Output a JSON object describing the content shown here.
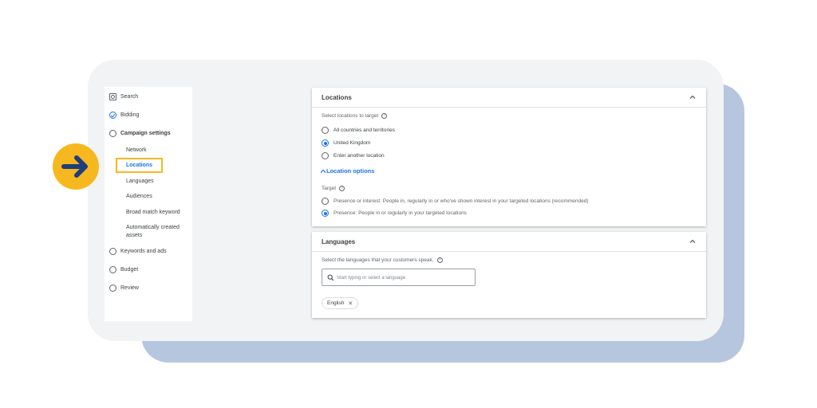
{
  "sidebar": {
    "items": [
      {
        "label": "Search",
        "icon": "search-icon"
      },
      {
        "label": "Bidding",
        "icon": "check-circle-icon"
      },
      {
        "label": "Campaign settings",
        "icon": "radio-empty-icon"
      },
      {
        "label": "Keywords and ads",
        "icon": "radio-empty-icon"
      },
      {
        "label": "Budget",
        "icon": "radio-empty-icon"
      },
      {
        "label": "Review",
        "icon": "radio-empty-icon"
      }
    ],
    "subitems": [
      "Network",
      "Locations",
      "Languages",
      "Audiences",
      "Broad match keyword",
      "Automatically created assets"
    ],
    "active_subitem": "Locations"
  },
  "locations": {
    "title": "Locations",
    "select_label": "Select locations to target",
    "options": [
      "All countries and territories",
      "United Kingdom",
      "Enter another location"
    ],
    "selected_option": "United Kingdom",
    "options_link": "Location options",
    "target_label": "Target",
    "target_options": [
      "Presence or interest: People in, regularly in or who've shown interest in your targeted locations (recommended)",
      "Presence: People in or regularly in your targeted locations"
    ],
    "selected_target": "Presence: People in or regularly in your targeted locations"
  },
  "languages": {
    "title": "Languages",
    "select_label": "Select the languages that your customers speak.",
    "search_placeholder": "Start typing or select a language",
    "selected_chips": [
      "English"
    ]
  },
  "colors": {
    "accent": "#1a73e8",
    "highlight": "#f7b81f",
    "arrow": "#1f3f7a",
    "back_card": "#b7c6df",
    "front_card": "#f1f3f5"
  },
  "icons": {
    "pointer": "arrow-right-icon",
    "collapse": "chevron-up-icon",
    "help": "help-circle-icon",
    "remove": "close-icon"
  }
}
